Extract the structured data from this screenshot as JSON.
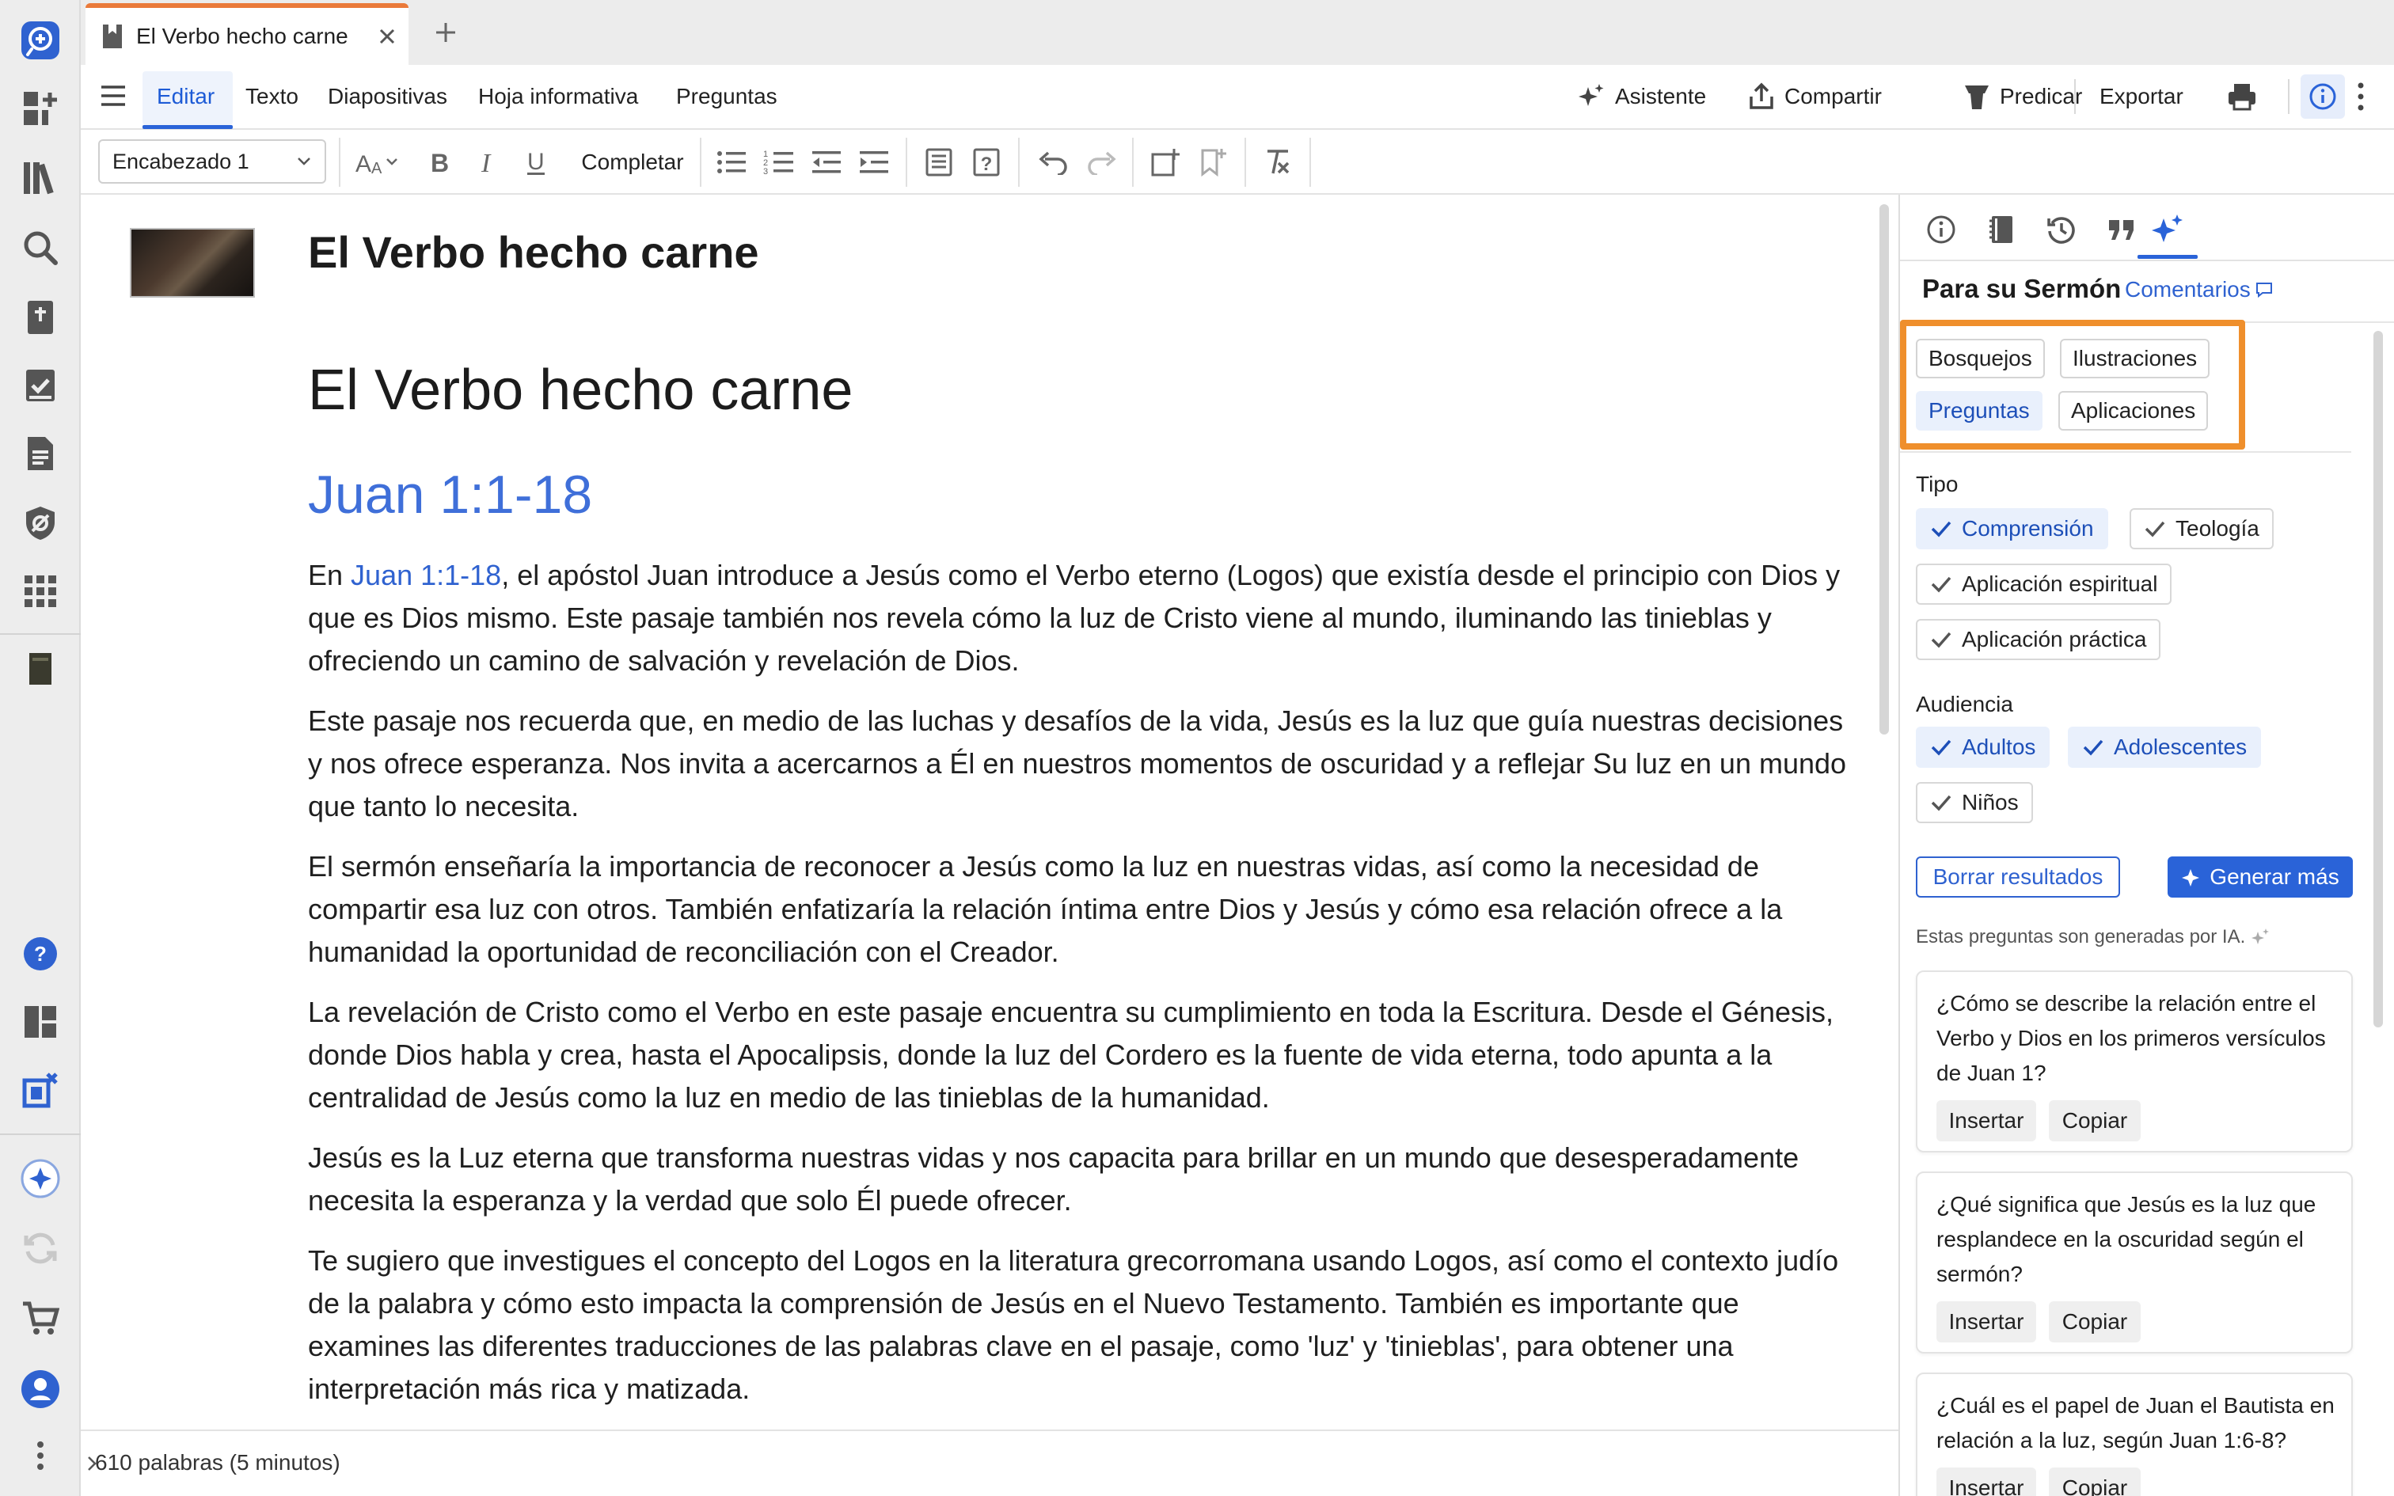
{
  "tab": {
    "title": "El Verbo hecho carne"
  },
  "menu": {
    "items": [
      "Editar",
      "Texto",
      "Diapositivas",
      "Hoja informativa",
      "Preguntas"
    ],
    "assistant": "Asistente",
    "share": "Compartir",
    "preach": "Predicar",
    "export": "Exportar"
  },
  "toolbar": {
    "style": "Encabezado 1",
    "complete": "Completar"
  },
  "document": {
    "header_title": "El Verbo hecho carne",
    "h1": "El Verbo hecho carne",
    "h2": "Juan 1:1-18",
    "p1_prefix": "En ",
    "p1_link": "Juan 1:1-18",
    "p1_rest": ", el apóstol Juan introduce a Jesús como el Verbo eterno (Logos) que existía desde el principio con Dios y que es Dios mismo. Este pasaje también nos revela cómo la luz de Cristo viene al mundo, iluminando las tinieblas y ofreciendo un camino de salvación y revelación de Dios.",
    "p2": "Este pasaje nos recuerda que, en medio de las luchas y desafíos de la vida, Jesús es la luz que guía nuestras decisiones y nos ofrece esperanza. Nos invita a acercarnos a Él en nuestros momentos de oscuridad y a reflejar Su luz en un mundo que tanto lo necesita.",
    "p3": "El sermón enseñaría la importancia de reconocer a Jesús como la luz en nuestras vidas, así como la necesidad de compartir esa luz con otros. También enfatizaría la relación íntima entre Dios y Jesús y cómo esa relación ofrece a la humanidad la oportunidad de reconciliación con el Creador.",
    "p4": "La revelación de Cristo como el Verbo en este pasaje encuentra su cumplimiento en toda la Escritura. Desde el Génesis, donde Dios habla y crea, hasta el Apocalipsis, donde la luz del Cordero es la fuente de vida eterna, todo apunta a la centralidad de Jesús como la luz en medio de las tinieblas de la humanidad.",
    "p5": "Jesús es la Luz eterna que transforma nuestras vidas y nos capacita para brillar en un mundo que desesperadamente necesita la esperanza y la verdad que solo Él puede ofrecer.",
    "p6": "Te sugiero que investigues el concepto del Logos en la literatura grecorromana usando Logos, así como el contexto judío de la palabra y cómo esto impacta la comprensión de Jesús en el Nuevo Testamento. También es importante que examines las diferentes traducciones de las palabras clave en el pasaje, como 'luz' y 'tinieblas', para obtener una interpretación más rica y matizada."
  },
  "status": {
    "word_count": "610 palabras (5 minutos)"
  },
  "panel": {
    "title": "Para su Sermón",
    "comments": "Comentarios",
    "categories": [
      "Bosquejos",
      "Ilustraciones",
      "Preguntas",
      "Aplicaciones"
    ],
    "selected_category": "Preguntas",
    "type_label": "Tipo",
    "types": [
      "Comprensión",
      "Teología",
      "Aplicación espiritual",
      "Aplicación práctica"
    ],
    "audience_label": "Audiencia",
    "audiences": [
      "Adultos",
      "Adolescentes",
      "Niños"
    ],
    "clear_button": "Borrar resultados",
    "more_button": "Generar más",
    "ai_note": "Estas preguntas son generadas por IA.",
    "questions": [
      "¿Cómo se describe la relación entre el Verbo y Dios en los primeros versículos de Juan 1?",
      "¿Qué significa que Jesús es la luz que resplandece en la oscuridad según el sermón?",
      "¿Cuál es el papel de Juan el Bautista en relación a la luz, según Juan 1:6-8?"
    ],
    "insert": "Insertar",
    "copy": "Copiar"
  },
  "colors": {
    "accent": "#2a63d8",
    "highlight": "#ef8f2c",
    "tab_accent": "#ea7a3a"
  }
}
